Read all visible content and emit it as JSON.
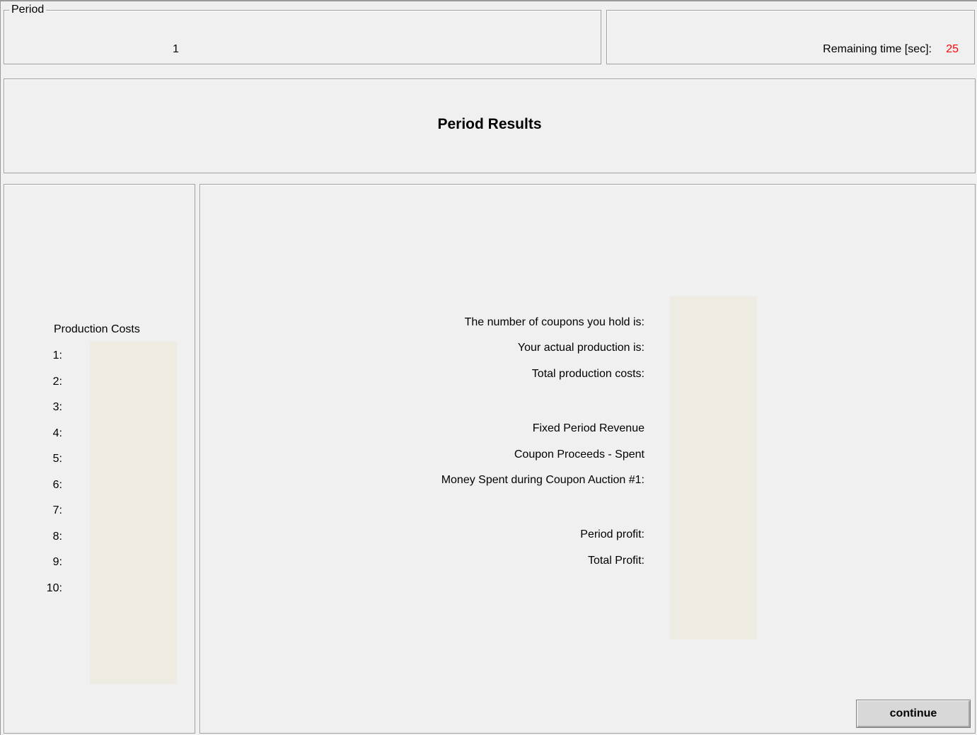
{
  "period": {
    "legend": "Period",
    "value": "1"
  },
  "timer": {
    "label": "Remaining time [sec]:",
    "value": "25",
    "value_color": "#ff0000"
  },
  "header": {
    "title": "Period Results"
  },
  "production_costs": {
    "title": "Production Costs",
    "rows": [
      "1:",
      "2:",
      "3:",
      "4:",
      "5:",
      "6:",
      "7:",
      "8:",
      "9:",
      "10:"
    ]
  },
  "results": {
    "labels": [
      "The number of coupons you hold is:",
      "Your actual production is:",
      "Total production costs:",
      "Fixed Period Revenue",
      "Coupon Proceeds - Spent",
      "Money Spent during Coupon Auction #1:",
      "Period profit:",
      "Total Profit:"
    ]
  },
  "continue_button": {
    "label": "continue"
  }
}
